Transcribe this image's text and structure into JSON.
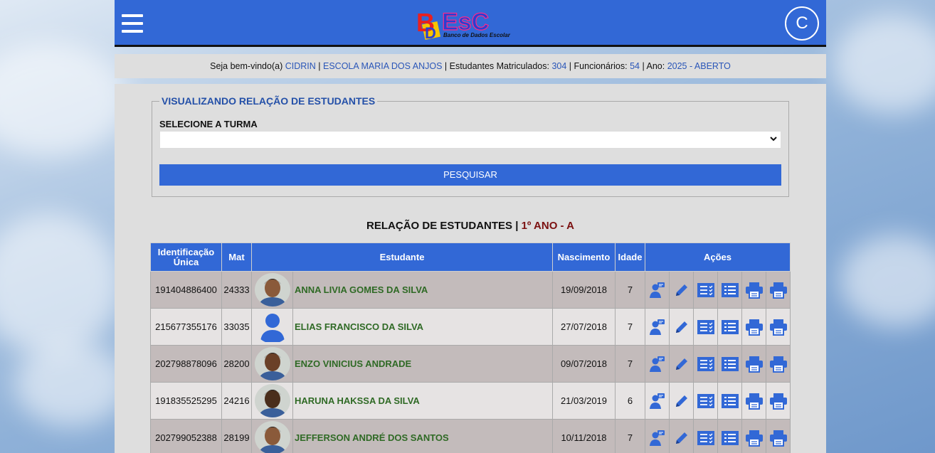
{
  "header": {
    "logo_text": "BDEsC",
    "logo_subtitle": "Banco de Dados Escolar",
    "circle_button_label": "C"
  },
  "info": {
    "welcome_label": "Seja bem-vindo(a)",
    "user": "CIDRIN",
    "school": "ESCOLA MARIA DOS ANJOS",
    "students_label": "Estudantes Matriculados:",
    "students_count": "304",
    "staff_label": "Funcionários:",
    "staff_count": "54",
    "year_label": "Ano:",
    "year_value": "2025 - ABERTO"
  },
  "filter": {
    "legend": "VISUALIZANDO RELAÇÃO DE ESTUDANTES",
    "select_label": "SELECIONE A TURMA",
    "select_value": "",
    "search_label": "PESQUISAR"
  },
  "list": {
    "title": "RELAÇÃO DE ESTUDANTES",
    "separator": "|",
    "turma": "1º ANO - A"
  },
  "table": {
    "headers": {
      "id": "Identificação Única",
      "mat": "Mat",
      "student": "Estudante",
      "birth": "Nascimento",
      "age": "Idade",
      "actions": "Ações"
    },
    "rows": [
      {
        "id": "191404886400",
        "mat": "24333",
        "name": "ANNA LIVIA GOMES DA SILVA",
        "birth": "19/09/2018",
        "age": "7",
        "photo": "photo"
      },
      {
        "id": "215677355176",
        "mat": "33035",
        "name": "ELIAS FRANCISCO DA SILVA",
        "birth": "27/07/2018",
        "age": "7",
        "photo": "placeholder"
      },
      {
        "id": "202798878096",
        "mat": "28200",
        "name": "ENZO VINICIUS ANDRADE",
        "birth": "09/07/2018",
        "age": "7",
        "photo": "photo"
      },
      {
        "id": "191835525295",
        "mat": "24216",
        "name": "HARUNA HAKSSA DA SILVA",
        "birth": "21/03/2019",
        "age": "6",
        "photo": "photo"
      },
      {
        "id": "202799052388",
        "mat": "28199",
        "name": "JEFFERSON ANDRÉ DOS SANTOS",
        "birth": "10/11/2018",
        "age": "7",
        "photo": "photo"
      }
    ]
  },
  "colors": {
    "primary": "#3268d6",
    "name_green": "#2f6a25",
    "turma_red": "#7b1010",
    "row_dark": "#c3bbbb",
    "row_light": "#e6e3e3"
  },
  "icons": [
    "menu-icon",
    "student-message-icon",
    "pencil-icon",
    "list-check-icon",
    "grid-list-icon",
    "printer-icon",
    "printer-alt-icon",
    "chevron-down-icon"
  ]
}
